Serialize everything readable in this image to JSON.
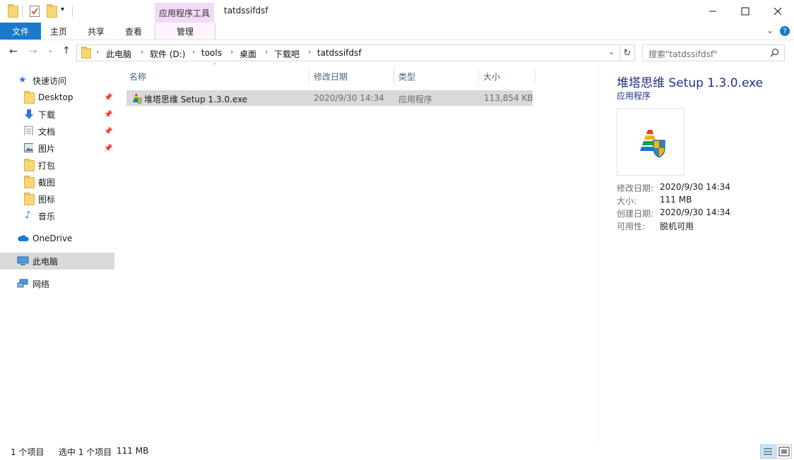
{
  "titlebar": {
    "context_tab_label": "应用程序工具",
    "window_title": "tatdssifdsf"
  },
  "ribbon": {
    "tabs": [
      {
        "label": "文件"
      },
      {
        "label": "主页"
      },
      {
        "label": "共享"
      },
      {
        "label": "查看"
      },
      {
        "label": "管理"
      }
    ]
  },
  "address": {
    "crumbs": [
      "此电脑",
      "软件 (D:)",
      "tools",
      "桌面",
      "下载吧",
      "tatdssifdsf"
    ],
    "search_placeholder": "搜索\"tatdssifdsf\""
  },
  "nav": {
    "quick_access": "快速访问",
    "items": [
      {
        "label": "Desktop",
        "icon": "folder-icon",
        "pinned": true
      },
      {
        "label": "下载",
        "icon": "download-arrow-icon",
        "pinned": true
      },
      {
        "label": "文档",
        "icon": "document-icon",
        "pinned": true
      },
      {
        "label": "图片",
        "icon": "picture-icon",
        "pinned": true
      },
      {
        "label": "打包",
        "icon": "folder-icon",
        "pinned": false
      },
      {
        "label": "截图",
        "icon": "folder-icon",
        "pinned": false
      },
      {
        "label": "图标",
        "icon": "folder-icon",
        "pinned": false
      },
      {
        "label": "音乐",
        "icon": "music-icon",
        "pinned": false
      }
    ],
    "onedrive": "OneDrive",
    "this_pc": "此电脑",
    "network": "网络"
  },
  "filelist": {
    "columns": [
      "名称",
      "修改日期",
      "类型",
      "大小"
    ],
    "rows": [
      {
        "name": "堆塔思维 Setup 1.3.0.exe",
        "modified": "2020/9/30 14:34",
        "type": "应用程序",
        "size": "113,854 KB"
      }
    ]
  },
  "details": {
    "title": "堆塔思维 Setup 1.3.0.exe",
    "type": "应用程序",
    "props": [
      {
        "k": "修改日期:",
        "v": "2020/9/30 14:34"
      },
      {
        "k": "大小:",
        "v": "111 MB"
      },
      {
        "k": "创建日期:",
        "v": "2020/9/30 14:34"
      },
      {
        "k": "可用性:",
        "v": "脱机可用"
      }
    ]
  },
  "status": {
    "count": "1 个项目",
    "selected": "选中 1 个项目",
    "size": "111 MB"
  },
  "colors": {
    "file_tab": "#1979ca",
    "context_tab": "#f3d9f7",
    "selected_row": "#d9d9d9",
    "details_title": "#1e3287"
  }
}
